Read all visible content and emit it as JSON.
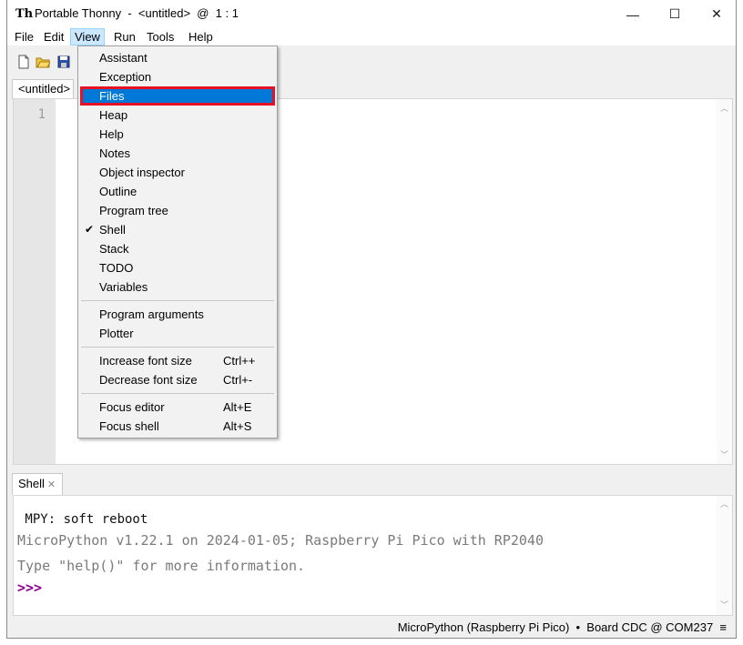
{
  "window": {
    "title": "Portable Thonny  -  <untitled>  @  1 : 1",
    "minimize_glyph": "—",
    "maximize_glyph": "☐",
    "close_glyph": "✕"
  },
  "menubar": [
    "File",
    "Edit",
    "View",
    "Run",
    "Tools",
    "Help"
  ],
  "toolbar": {
    "icons": [
      "new-file-icon",
      "open-file-icon",
      "save-file-icon"
    ]
  },
  "editor": {
    "tab_label": "<untitled>",
    "line_numbers": [
      "1"
    ]
  },
  "view_menu": {
    "group1": [
      {
        "label": "Assistant",
        "checked": false,
        "selected": false
      },
      {
        "label": "Exception",
        "checked": false,
        "selected": false
      },
      {
        "label": "Files",
        "checked": false,
        "selected": true
      },
      {
        "label": "Heap",
        "checked": false,
        "selected": false
      },
      {
        "label": "Help",
        "checked": false,
        "selected": false
      },
      {
        "label": "Notes",
        "checked": false,
        "selected": false
      },
      {
        "label": "Object inspector",
        "checked": false,
        "selected": false
      },
      {
        "label": "Outline",
        "checked": false,
        "selected": false
      },
      {
        "label": "Program tree",
        "checked": false,
        "selected": false
      },
      {
        "label": "Shell",
        "checked": true,
        "selected": false
      },
      {
        "label": "Stack",
        "checked": false,
        "selected": false
      },
      {
        "label": "TODO",
        "checked": false,
        "selected": false
      },
      {
        "label": "Variables",
        "checked": false,
        "selected": false
      }
    ],
    "group2": [
      {
        "label": "Program arguments"
      },
      {
        "label": "Plotter"
      }
    ],
    "group3": [
      {
        "label": "Increase font size",
        "shortcut": "Ctrl++"
      },
      {
        "label": "Decrease font size",
        "shortcut": "Ctrl+-"
      }
    ],
    "group4": [
      {
        "label": "Focus editor",
        "shortcut": "Alt+E"
      },
      {
        "label": "Focus shell",
        "shortcut": "Alt+S"
      }
    ],
    "check_glyph": "✔"
  },
  "shell": {
    "tab_label": "Shell",
    "tab_close": "✕",
    "lines": [
      " MPY: soft reboot",
      "MicroPython v1.22.1 on 2024-01-05; Raspberry Pi Pico with RP2040",
      "Type \"help()\" for more information.",
      ">>>"
    ]
  },
  "status": {
    "text": "MicroPython (Raspberry Pi Pico)  •  Board CDC @ COM237  ≡"
  },
  "colors": {
    "selection": "#0078d7",
    "highlight_box": "#e81123",
    "prompt": "#8b008b"
  }
}
